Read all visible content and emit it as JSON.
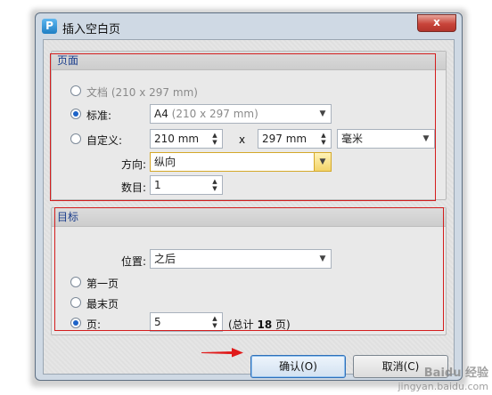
{
  "dialog": {
    "title": "插入空白页",
    "app_icon_letter": "P",
    "close_label": "x"
  },
  "page_group": {
    "title": "页面",
    "options": {
      "doc": {
        "label": "文档",
        "hint": "(210 x 297 mm)"
      },
      "standard": {
        "label": "标准:"
      },
      "custom": {
        "label": "自定义:"
      }
    },
    "selected": "standard",
    "standard_select": {
      "value": "A4",
      "hint": "(210 x 297 mm)"
    },
    "custom_width": "210 mm",
    "times": "x",
    "custom_height": "297 mm",
    "unit": "毫米",
    "orientation_label": "方向:",
    "orientation_value": "纵向",
    "count_label": "数目:",
    "count_value": "1"
  },
  "target_group": {
    "title": "目标",
    "position_label": "位置:",
    "position_value": "之后",
    "options": {
      "first": {
        "label": "第一页"
      },
      "last": {
        "label": "最末页"
      },
      "page": {
        "label": "页:"
      }
    },
    "selected": "page",
    "page_value": "5",
    "total_prefix": "(总计 ",
    "total_count": "18",
    "total_suffix": " 页)"
  },
  "buttons": {
    "ok": "确认(O)",
    "cancel": "取消(C)"
  },
  "watermark": {
    "main": "Baidu 经验",
    "sub": "jingyan.baidu.com"
  },
  "colors": {
    "annotation_red": "#d41d1d",
    "radio_selected": "#1d63c8"
  }
}
